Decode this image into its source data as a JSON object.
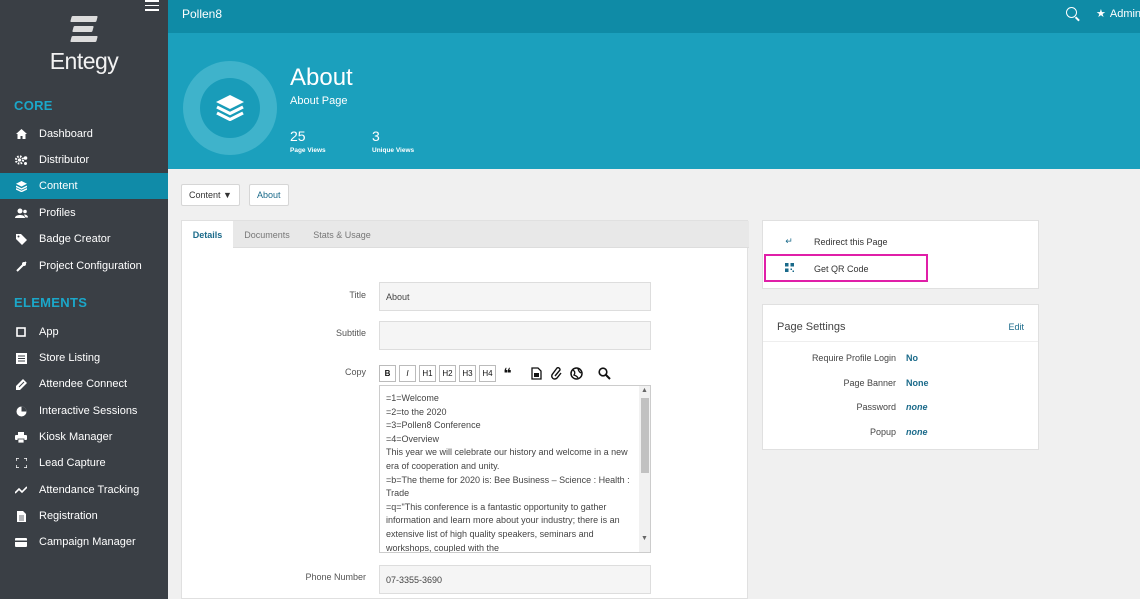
{
  "app": {
    "name": "Pollen8",
    "user": "Admin"
  },
  "logo": {
    "text": "Entegy"
  },
  "sidebar": {
    "sections": [
      {
        "title": "CORE",
        "items": [
          {
            "label": "Dashboard",
            "icon": "home-icon"
          },
          {
            "label": "Distributor",
            "icon": "gears-icon"
          },
          {
            "label": "Content",
            "icon": "layers-icon",
            "active": true
          },
          {
            "label": "Profiles",
            "icon": "users-icon"
          },
          {
            "label": "Badge Creator",
            "icon": "tag-icon"
          },
          {
            "label": "Project Configuration",
            "icon": "tools-icon"
          }
        ]
      },
      {
        "title": "ELEMENTS",
        "items": [
          {
            "label": "App",
            "icon": "square-icon"
          },
          {
            "label": "Store Listing",
            "icon": "list-icon"
          },
          {
            "label": "Attendee Connect",
            "icon": "connect-icon"
          },
          {
            "label": "Interactive Sessions",
            "icon": "pie-icon"
          },
          {
            "label": "Kiosk Manager",
            "icon": "printer-icon"
          },
          {
            "label": "Lead Capture",
            "icon": "scan-icon"
          },
          {
            "label": "Attendance Tracking",
            "icon": "trend-icon"
          },
          {
            "label": "Registration",
            "icon": "file-icon"
          },
          {
            "label": "Campaign Manager",
            "icon": "card-icon"
          }
        ]
      }
    ]
  },
  "header": {
    "title": "About",
    "subtitle": "About Page",
    "stats": [
      {
        "value": "25",
        "label": "Page Views"
      },
      {
        "value": "3",
        "label": "Unique Views"
      }
    ]
  },
  "breadcrumb": {
    "dropdown": "Content ▼",
    "current": "About"
  },
  "tabs": [
    {
      "label": "Details",
      "active": true
    },
    {
      "label": "Documents"
    },
    {
      "label": "Stats & Usage"
    }
  ],
  "form": {
    "title_label": "Title",
    "title_value": "About",
    "subtitle_label": "Subtitle",
    "subtitle_value": "",
    "copy_label": "Copy",
    "toolbar": [
      "B",
      "I",
      "H1",
      "H2",
      "H3",
      "H4"
    ],
    "copy_lines": [
      "=1=Welcome",
      "=2=to the 2020",
      "=3=Pollen8 Conference",
      "=4=Overview",
      "This year we will celebrate our history and welcome in a new era of cooperation and unity.",
      "=b=The theme for 2020 is: Bee Business – Science : Health : Trade",
      "=q=\"This conference is a fantastic opportunity to gather information and learn more about your industry; there is an extensive list of high quality speakers, seminars and workshops, coupled with the"
    ],
    "phone_label": "Phone Number",
    "phone_value": "07-3355-3690"
  },
  "actions": [
    {
      "label": "Redirect this Page",
      "icon": "redirect-icon"
    },
    {
      "label": "Get QR Code",
      "icon": "qr-code-icon"
    }
  ],
  "page_settings": {
    "title": "Page Settings",
    "edit": "Edit",
    "rows": [
      {
        "label": "Require Profile Login",
        "value": "No"
      },
      {
        "label": "Page Banner",
        "value": "None"
      },
      {
        "label": "Password",
        "value": "none"
      },
      {
        "label": "Popup",
        "value": "none"
      }
    ]
  }
}
